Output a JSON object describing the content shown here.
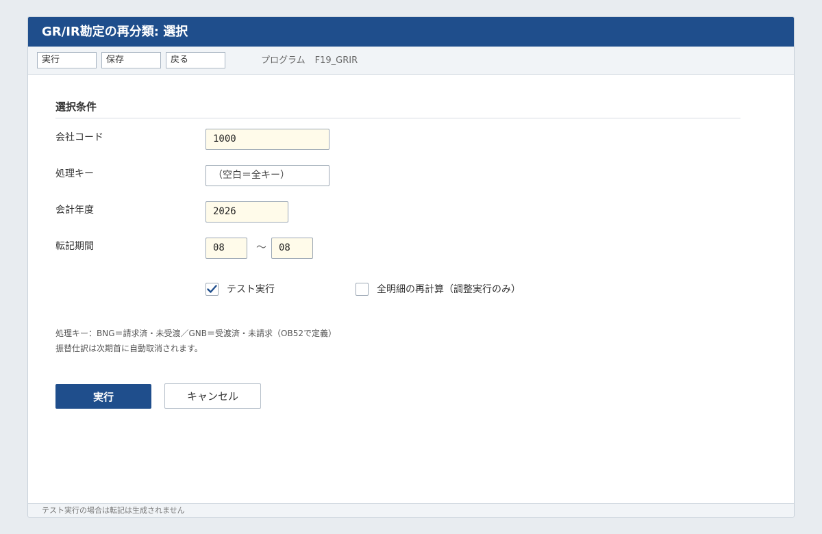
{
  "window": {
    "title": "GR/IR勘定の再分類: 選択"
  },
  "toolbar": {
    "run_label": "実行",
    "save_label": "保存",
    "back_label": "戻る",
    "program_label": "プログラム",
    "program_value": "F19_GRIR"
  },
  "form": {
    "section_title": "選択条件",
    "company_code": {
      "label": "会社コード",
      "value": "1000"
    },
    "processing_key": {
      "label": "処理キー",
      "placeholder": "（空白＝全キー）"
    },
    "fiscal_year": {
      "label": "会計年度",
      "value": "2026"
    },
    "posting_period": {
      "label": "転記期間",
      "from": "08",
      "separator": "～",
      "to": "08"
    },
    "test_run": {
      "label": "テスト実行",
      "checked": true
    },
    "recalc_all": {
      "label": "全明細の再計算（調整実行のみ）",
      "checked": false
    },
    "note1": "処理キー：BNG＝請求済・未受渡／GNB＝受渡済・未請求（OB52で定義）",
    "note2": "振替仕訳は次期首に自動取消されます。"
  },
  "actions": {
    "execute_label": "実行",
    "cancel_label": "キャンセル"
  },
  "status": {
    "text": "テスト実行の場合は転記は生成されません"
  },
  "colors": {
    "accent": "#1f4e8c",
    "input_bg": "#fffbea"
  },
  "icons": {
    "checkbox_checked": "checkmark-icon"
  }
}
